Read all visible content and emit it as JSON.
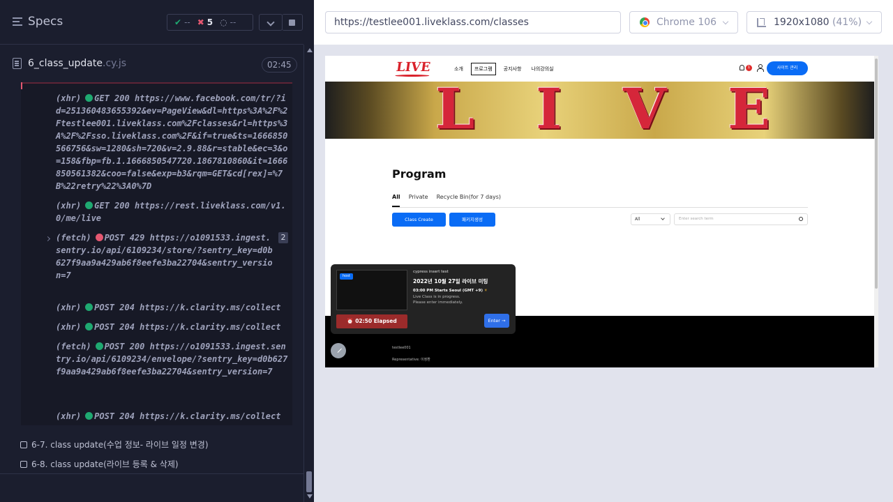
{
  "runner": {
    "specs_title": "Specs",
    "stats": {
      "passed": "--",
      "failed": "5",
      "pending": "--"
    },
    "spec_file": {
      "name": "6_class_update",
      "ext": ".cy.js",
      "duration": "02:45"
    },
    "log_entries": [
      {
        "kind": "(xhr)",
        "status": "green",
        "method_status": "GET 200",
        "url": "https://www.facebook.com/tr/?id=251360483655392&ev=PageView&dl=https%3A%2F%2Ftestlee001.liveklass.com%2Fclasses&rl=https%3A%2F%2Fsso.liveklass.com%2F&if=true&ts=1666850566756&sw=1280&sh=720&v=2.9.88&r=stable&ec=3&o=158&fbp=fb.1.1666850547720.1867810860&it=1666850561382&coo=false&exp=b3&rqm=GET&cd[rex]=%7B%22retry%22%3A0%7D"
      },
      {
        "kind": "(xhr)",
        "status": "green",
        "method_status": "GET 200",
        "url": "https://rest.liveklass.com/v1.0/me/live"
      },
      {
        "kind": "(fetch)",
        "status": "red",
        "method_status": "POST 429",
        "url": "https://o1091533.ingest.sentry.io/api/6109234/store/?sentry_key=d0b627f9aa9a429ab6f8eefe3ba22704&sentry_version=7",
        "count": "2"
      },
      {
        "kind": "(xhr)",
        "status": "green",
        "method_status": "POST 204",
        "url": "https://k.clarity.ms/collect"
      },
      {
        "kind": "(xhr)",
        "status": "green",
        "method_status": "POST 204",
        "url": "https://k.clarity.ms/collect"
      },
      {
        "kind": "(fetch)",
        "status": "green",
        "method_status": "POST 200",
        "url": "https://o1091533.ingest.sentry.io/api/6109234/envelope/?sentry_key=d0b627f9aa9a429ab6f8eefe3ba22704&sentry_version=7"
      },
      {
        "kind": "(xhr)",
        "status": "green",
        "method_status": "POST 204",
        "url": "https://k.clarity.ms/collect"
      }
    ],
    "tests": [
      "6-7. class update(수업 정보- 라이브 일정 변경)",
      "6-8. class update(라이브 등록 & 삭제)"
    ]
  },
  "preview": {
    "url": "https://testlee001.liveklass.com/classes",
    "browser": "Chrome 106",
    "viewport": "1920x1080",
    "zoom": "(41%)"
  },
  "site": {
    "logo": "LIVE",
    "nav": [
      "소개",
      "프로그램",
      "공지사항",
      "나의강의실"
    ],
    "active_nav_index": 1,
    "bell_count": "1",
    "admin_button": "사이트 관리",
    "banner_text": "LIVE",
    "program_title": "Program",
    "tabs": [
      "All",
      "Private",
      "Recycle Bin(for 7 days)"
    ],
    "create_button": "Class Create",
    "package_button": "패키지생성",
    "filter_select": "All",
    "search_placeholder": "Enter search term",
    "footer_lines": [
      "testlee001",
      "Representative: 이정환"
    ],
    "live_card": {
      "host_badge": "host",
      "event_name": "cypress insert test",
      "title": "2022년 10월 27일 라이브 미팅",
      "time": "03:00 PM Starts Seoul (GMT +9)",
      "note_line1": "Live Class is in progress.",
      "note_line2": "Please enter immediately.",
      "elapsed": "02:50 Elapsed",
      "enter": "Enter"
    }
  }
}
